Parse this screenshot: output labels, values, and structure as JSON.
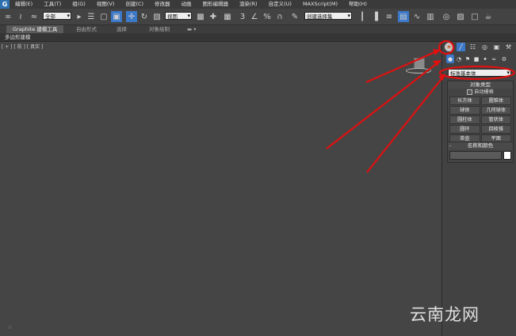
{
  "menubar": {
    "items": [
      "编辑(E)",
      "工具(T)",
      "组(G)",
      "视图(V)",
      "创建(C)",
      "修改器",
      "动画",
      "图形编辑器",
      "渲染(R)",
      "自定义(U)",
      "MAXScript(M)",
      "帮助(H)"
    ]
  },
  "toolbar": {
    "selection_filter": "全部",
    "reference_coord": "视图",
    "named_selection": "创建选择集"
  },
  "ribbon": {
    "tabs": [
      "Graphite 建模工具",
      "自由形式",
      "选择",
      "对象绘制"
    ],
    "sub_label": "多边形建模"
  },
  "viewport": {
    "label": "[ + ] [ 前 ] [ 真实 ]"
  },
  "command_panel": {
    "category_dropdown": "标准基本体",
    "object_type": {
      "title": "对象类型",
      "auto_grid": "自动栅格",
      "buttons": [
        "长方体",
        "圆锥体",
        "球体",
        "几何球体",
        "圆柱体",
        "管状体",
        "圆环",
        "四棱锥",
        "茶壶",
        "平面"
      ]
    },
    "name_color": {
      "title": "名称和颜色"
    }
  },
  "watermark": "云南龙网",
  "colors": {
    "annotation_red": "#e01010",
    "ui_dark": "#444444",
    "highlight_blue": "#3b78c8"
  }
}
